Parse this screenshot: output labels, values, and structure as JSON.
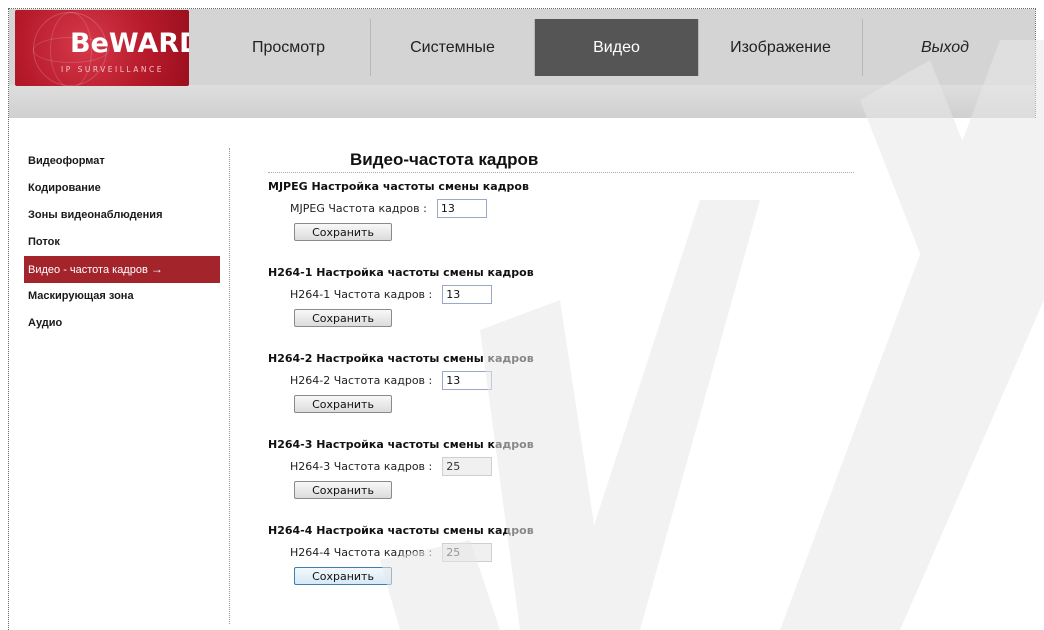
{
  "logo": {
    "brand": "BeWARD",
    "tagline": "IP SURVEILLANCE",
    "color": "#b81b2b"
  },
  "nav": {
    "tabs": [
      {
        "label": "Просмотр",
        "active": false
      },
      {
        "label": "Системные",
        "active": false
      },
      {
        "label": "Видео",
        "active": true
      },
      {
        "label": "Изображение",
        "active": false
      },
      {
        "label": "Выход",
        "active": false
      }
    ]
  },
  "sidebar": {
    "items": [
      {
        "label": "Видеоформат"
      },
      {
        "label": "Кодирование"
      },
      {
        "label": "Зоны видеонаблюдения"
      },
      {
        "label": "Поток"
      },
      {
        "label": "Видео - частота кадров",
        "active": true,
        "arrow": "→"
      },
      {
        "label": "Маскирующая зона"
      },
      {
        "label": "Аудио"
      }
    ]
  },
  "page": {
    "title": "Видео-частота кадров"
  },
  "sections": [
    {
      "heading": "MJPEG Настройка частоты смены кадров",
      "label": "MJPEG Частота кадров :",
      "value": "13",
      "enabled": true,
      "button": "Сохранить"
    },
    {
      "heading": "H264-1 Настройка частоты смены кадров",
      "label": "H264-1 Частота кадров :",
      "value": "13",
      "enabled": true,
      "button": "Сохранить"
    },
    {
      "heading": "H264-2 Настройка частоты смены кадров",
      "label": "H264-2 Частота кадров :",
      "value": "13",
      "enabled": true,
      "button": "Сохранить"
    },
    {
      "heading": "H264-3 Настройка частоты смены кадров",
      "label": "H264-3 Частота кадров :",
      "value": "25",
      "enabled": false,
      "button": "Сохранить"
    },
    {
      "heading": "H264-4 Настройка частоты смены кадров",
      "label": "H264-4 Частота кадров :",
      "value": "25",
      "enabled": false,
      "button": "Сохранить"
    }
  ],
  "colors": {
    "accent": "#a4242c",
    "active_tab": "#555555",
    "header": "#d4d4d4"
  }
}
